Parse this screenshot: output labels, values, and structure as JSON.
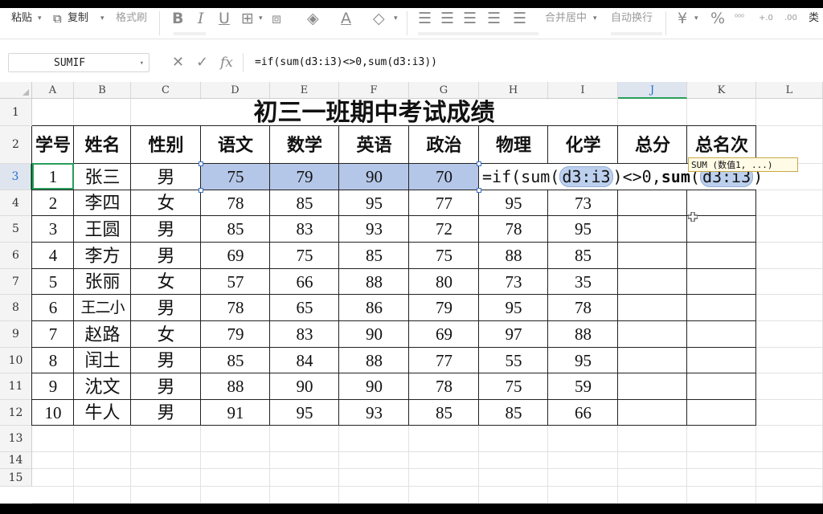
{
  "ribbon": {
    "paste": "粘贴",
    "copy": "复制",
    "format_painter": "格式刷",
    "bold": "B",
    "italic": "I",
    "underline": "U",
    "merge_center": "合并居中",
    "wrap_text": "自动换行",
    "currency": "¥",
    "percent": "%",
    "decimal_more": "⁰⁰⁰",
    "decimal_inc": "+.0",
    "decimal_dec": ".00",
    "more": "类"
  },
  "formula_bar": {
    "name_box": "SUMIF",
    "fx": "fx",
    "formula": "=if(sum(d3:i3)<>0,sum(d3:i3))"
  },
  "columns": [
    "A",
    "B",
    "C",
    "D",
    "E",
    "F",
    "G",
    "H",
    "I",
    "J",
    "K",
    "L"
  ],
  "rows": [
    "1",
    "2",
    "3",
    "4",
    "5",
    "6",
    "7",
    "8",
    "9",
    "10",
    "11",
    "12",
    "13",
    "14",
    "15"
  ],
  "sheet": {
    "title": "初三一班期中考试成绩",
    "headers": [
      "学号",
      "姓名",
      "性别",
      "语文",
      "数学",
      "英语",
      "政治",
      "物理",
      "化学",
      "总分",
      "总名次"
    ],
    "records": [
      [
        "1",
        "张三",
        "男",
        "75",
        "79",
        "90",
        "70"
      ],
      [
        "2",
        "李四",
        "女",
        "78",
        "85",
        "95",
        "77",
        "95",
        "73"
      ],
      [
        "3",
        "王圆",
        "男",
        "85",
        "83",
        "93",
        "72",
        "78",
        "95"
      ],
      [
        "4",
        "李方",
        "男",
        "69",
        "75",
        "85",
        "75",
        "88",
        "85"
      ],
      [
        "5",
        "张丽",
        "女",
        "57",
        "66",
        "88",
        "80",
        "73",
        "35"
      ],
      [
        "6",
        "王二小",
        "男",
        "78",
        "65",
        "86",
        "79",
        "95",
        "78"
      ],
      [
        "7",
        "赵路",
        "女",
        "79",
        "83",
        "90",
        "69",
        "97",
        "88"
      ],
      [
        "8",
        "闰土",
        "男",
        "85",
        "84",
        "88",
        "77",
        "55",
        "95"
      ],
      [
        "9",
        "沈文",
        "男",
        "88",
        "90",
        "90",
        "78",
        "75",
        "59"
      ],
      [
        "10",
        "牛人",
        "男",
        "91",
        "95",
        "93",
        "85",
        "85",
        "66"
      ]
    ]
  },
  "editing": {
    "p1": "=if(sum(",
    "ref1": "d3:i3",
    "p2": ")<>0,",
    "fn2": "sum",
    "p3": "(",
    "ref2": "d3:i3",
    "p4": ")"
  },
  "tooltip": "SUM (数值1, ...)"
}
